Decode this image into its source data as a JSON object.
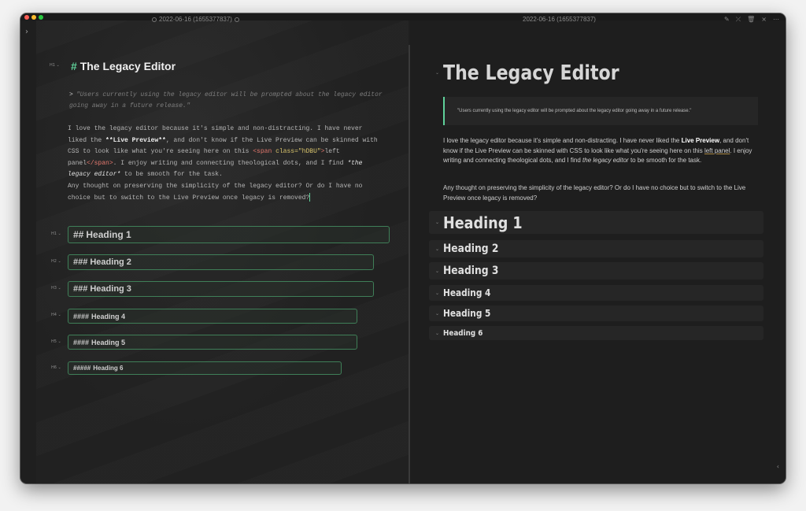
{
  "window": {
    "traffic_lights": [
      "close",
      "minimize",
      "maximize"
    ]
  },
  "sidebar_toggle_glyph": "›",
  "left_tab": {
    "title": "2022-06-16 (1655377837)"
  },
  "right_tab": {
    "title": "2022-06-16 (1655377837)"
  },
  "actions": [
    "pencil-icon",
    "unlink-icon",
    "trash-icon",
    "close-icon",
    "more-icon"
  ],
  "action_glyphs": [
    "✎",
    "⤫",
    "🗑",
    "×",
    "⋯"
  ],
  "editor": {
    "title_hash": "#",
    "title": "The Legacy Editor",
    "h1_tag": "H1",
    "quote_marker": ">",
    "quote": "\"Users currently using the legacy editor will be prompted about the legacy editor going away in a future release.\"",
    "p1_a": "I love the legacy editor because it's simple and non-distracting. I have never liked the ",
    "p1_bold": "**Live Preview**",
    "p1_b": ", and don't know if the Live Preview can be skinned with CSS to look like what you're seeing here on this ",
    "p1_tag_open": "<span ",
    "p1_attr": "class=\"hDBU\"",
    "p1_tag_close": ">",
    "p1_inner": "left panel",
    "p1_tag_end": "</span>",
    "p1_c": ". I enjoy writing and connecting theological dots, and I find ",
    "p1_ital": "*the legacy editor*",
    "p1_d": " to be smooth for the task.",
    "p2": "Any thought on preserving the simplicity of the legacy editor? Or do I have no choice but to switch to the Live Preview once legacy is removed?",
    "headings": [
      {
        "hash": "##",
        "text": "Heading 1",
        "tag": "H1"
      },
      {
        "hash": "###",
        "text": "Heading 2",
        "tag": "H2"
      },
      {
        "hash": "###",
        "text": "Heading 3",
        "tag": "H3"
      },
      {
        "hash": "####",
        "text": "Heading 4",
        "tag": "H4"
      },
      {
        "hash": "####",
        "text": "Heading 5",
        "tag": "H5"
      },
      {
        "hash": "#####",
        "text": "Heading 6",
        "tag": "H6"
      }
    ]
  },
  "preview": {
    "title": "The Legacy Editor",
    "quote": "\"Users currently using the legacy editor will be prompted about the legacy editor going away in a future release.\"",
    "p1_a": "I love the legacy editor because it's simple and non-distracting. I have never liked the ",
    "p1_bold": "Live Preview",
    "p1_b": ", and don't know if the Live Preview can be skinned with CSS to look like what you're seeing here on this ",
    "p1_link": "left panel",
    "p1_c": ". I enjoy writing and connecting theological dots, and I find ",
    "p1_ital": "the legacy editor",
    "p1_d": " to be smooth for the task.",
    "p2": "Any thought on preserving the simplicity of the legacy editor? Or do I have no choice but to switch to the Live Preview once legacy is removed?",
    "headings": [
      "Heading 1",
      "Heading 2",
      "Heading 3",
      "Heading 4",
      "Heading 5",
      "Heading 6"
    ]
  },
  "fold_glyph": "⌄",
  "collapse_glyph": "‹"
}
